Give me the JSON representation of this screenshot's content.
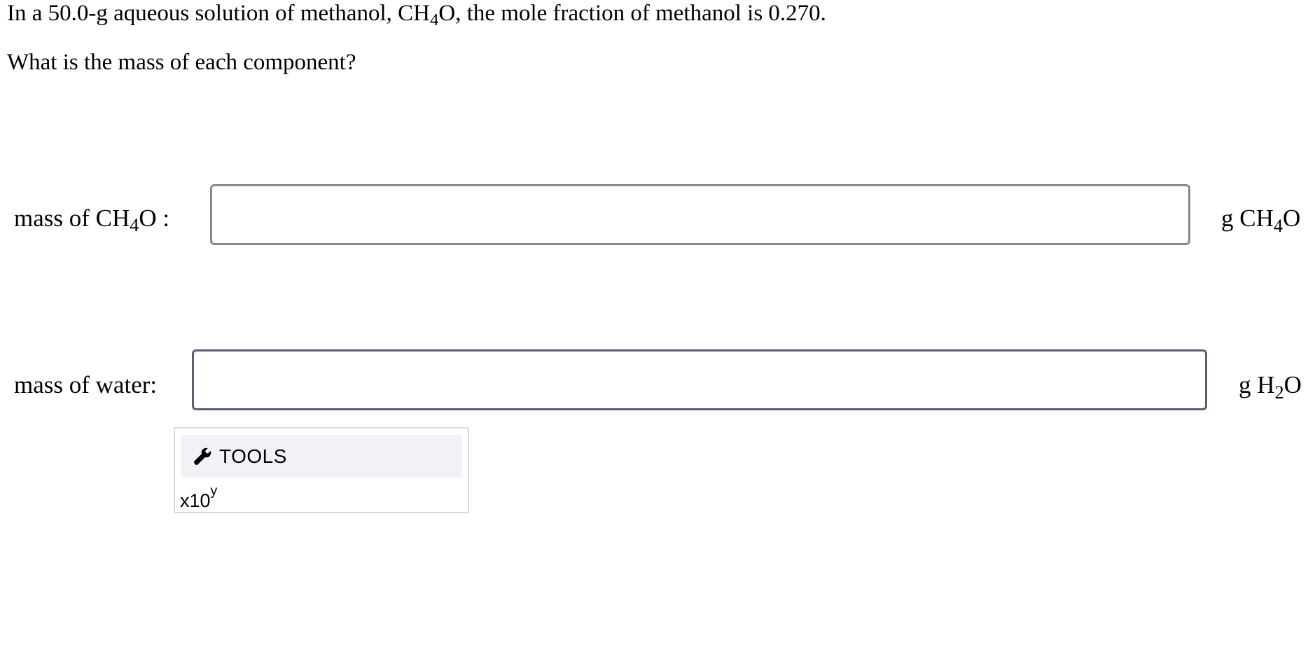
{
  "question": {
    "line1": {
      "before": "In a 50.0-g aqueous solution of methanol, CH",
      "sub": "4",
      "after": "O, the mole fraction of methanol is 0.270."
    },
    "line2": "What is the mass of each component?"
  },
  "fields": [
    {
      "label_before": "mass of CH",
      "label_sub": "4",
      "label_after": "O :",
      "value": "",
      "unit_before": "g CH",
      "unit_sub": "4",
      "unit_after": "O"
    },
    {
      "label_before": "mass of water:",
      "label_sub": "",
      "label_after": "",
      "value": "",
      "unit_before": "g H",
      "unit_sub": "2",
      "unit_after": "O"
    }
  ],
  "tools": {
    "label": "TOOLS",
    "icon": "wrench-icon",
    "exp_base": "x10",
    "exp_sup": "y"
  }
}
